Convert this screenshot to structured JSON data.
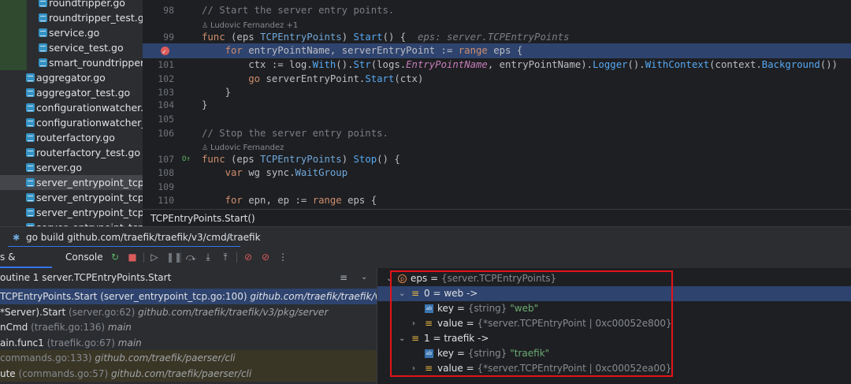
{
  "project_tree": {
    "items": [
      {
        "label": "roundtripper.go",
        "indent": 2
      },
      {
        "label": "roundtripper_test.go",
        "indent": 2
      },
      {
        "label": "service.go",
        "indent": 2
      },
      {
        "label": "service_test.go",
        "indent": 2
      },
      {
        "label": "smart_roundtripper.go",
        "indent": 2
      },
      {
        "label": "aggregator.go",
        "indent": 1
      },
      {
        "label": "aggregator_test.go",
        "indent": 1
      },
      {
        "label": "configurationwatcher.go",
        "indent": 1
      },
      {
        "label": "configurationwatcher_tes",
        "indent": 1
      },
      {
        "label": "routerfactory.go",
        "indent": 1
      },
      {
        "label": "routerfactory_test.go",
        "indent": 1
      },
      {
        "label": "server.go",
        "indent": 1
      },
      {
        "label": "server_entrypoint_tcp.go",
        "indent": 1,
        "selected": true
      },
      {
        "label": "server_entrypoint_tcp_htt",
        "indent": 1
      },
      {
        "label": "server_entrypoint_tcp_htt",
        "indent": 1
      },
      {
        "label": "server_entrypoint_tcp_tes",
        "indent": 1
      }
    ]
  },
  "editor": {
    "lines": [
      {
        "num": "98",
        "tokens": [
          [
            "cm",
            "// Start the server entry points."
          ]
        ]
      },
      {
        "author": "Ludovic Fernandez +1"
      },
      {
        "num": "99",
        "tokens": [
          [
            "kw",
            "func "
          ],
          [
            "pl",
            "(eps "
          ],
          [
            "ty",
            "TCPEntryPoints"
          ],
          [
            "pl",
            ") "
          ],
          [
            "fn",
            "Start"
          ],
          [
            "pl",
            "() {  "
          ],
          [
            "hint",
            "eps: server.TCPEntryPoints"
          ]
        ]
      },
      {
        "num": "",
        "breakpoint": true,
        "highlight": true,
        "tokens": [
          [
            "pl",
            "    "
          ],
          [
            "kw",
            "for "
          ],
          [
            "pl",
            "entryPointName, serverEntryPoint := "
          ],
          [
            "kw",
            "range "
          ],
          [
            "pl",
            "eps {"
          ]
        ]
      },
      {
        "num": "101",
        "tokens": [
          [
            "pl",
            "        ctx := log."
          ],
          [
            "fn",
            "With"
          ],
          [
            "pl",
            "()."
          ],
          [
            "fn",
            "Str"
          ],
          [
            "pl",
            "(logs."
          ],
          [
            "it",
            "EntryPointName"
          ],
          [
            "pl",
            ", entryPointName)."
          ],
          [
            "fn",
            "Logger"
          ],
          [
            "pl",
            "()."
          ],
          [
            "fn",
            "WithContext"
          ],
          [
            "pl",
            "(context."
          ],
          [
            "fn",
            "Background"
          ],
          [
            "pl",
            "())"
          ]
        ]
      },
      {
        "num": "102",
        "tokens": [
          [
            "pl",
            "        "
          ],
          [
            "kw",
            "go "
          ],
          [
            "pl",
            "serverEntryPoint."
          ],
          [
            "fn",
            "Start"
          ],
          [
            "pl",
            "(ctx)"
          ]
        ]
      },
      {
        "num": "103",
        "tokens": [
          [
            "pl",
            "    }"
          ]
        ]
      },
      {
        "num": "104",
        "tokens": [
          [
            "pl",
            "}"
          ]
        ]
      },
      {
        "num": "105",
        "tokens": []
      },
      {
        "num": "106",
        "tokens": [
          [
            "cm",
            "// Stop the server entry points."
          ]
        ]
      },
      {
        "author": "Ludovic Fernandez"
      },
      {
        "num": "107",
        "impl": true,
        "tokens": [
          [
            "kw",
            "func "
          ],
          [
            "pl",
            "(eps "
          ],
          [
            "ty",
            "TCPEntryPoints"
          ],
          [
            "pl",
            ") "
          ],
          [
            "fn",
            "Stop"
          ],
          [
            "pl",
            "() {"
          ]
        ]
      },
      {
        "num": "108",
        "tokens": [
          [
            "pl",
            "    "
          ],
          [
            "kw",
            "var "
          ],
          [
            "pl",
            "wg sync."
          ],
          [
            "ty",
            "WaitGroup"
          ]
        ]
      },
      {
        "num": "109",
        "tokens": []
      },
      {
        "num": "110",
        "tokens": [
          [
            "pl",
            "    "
          ],
          [
            "kw",
            "for "
          ],
          [
            "pl",
            "epn, ep := "
          ],
          [
            "kw",
            "range "
          ],
          [
            "pl",
            "eps {"
          ]
        ]
      }
    ],
    "breadcrumb": "TCPEntryPoints.Start()"
  },
  "run_tab": {
    "label": "go build github.com/traefik/traefik/v3/cmd/traefik",
    "close": "×"
  },
  "debug_toolbar": {
    "tab_frames": "s & Variables",
    "tab_console": "Console",
    "buttons": [
      "rerun-icon",
      "stop-icon",
      "resume-icon",
      "pause-icon",
      "step-over-icon",
      "step-into-icon",
      "step-out-icon",
      "view-breakpoints-icon",
      "mute-breakpoints-icon",
      "more-icon"
    ]
  },
  "frames": {
    "thread": "outine 1 server.TCPEntryPoints.Start",
    "items": [
      {
        "name": "TCPEntryPoints.Start",
        "loc": "(server_entrypoint_tcp.go:100)",
        "pkg": "github.com/traefik/traefik/v3/pkg/serv",
        "selected": true,
        "loc_plain": true
      },
      {
        "name": "*Server).Start",
        "loc": "(server.go:62)",
        "pkg": "github.com/traefik/traefik/v3/pkg/server"
      },
      {
        "name": "nCmd",
        "loc": "(traefik.go:136)",
        "pkg": "main"
      },
      {
        "name": "ain.func1",
        "loc": "(traefik.go:67)",
        "pkg": "main"
      },
      {
        "name": "",
        "loc": "commands.go:133)",
        "pkg": "github.com/traefik/paerser/cli",
        "lib": true
      },
      {
        "name": "ute",
        "loc": "(commands.go:57)",
        "pkg": "github.com/traefik/paerser/cli",
        "lib": true
      }
    ]
  },
  "variables": {
    "rows": [
      {
        "indent": 0,
        "chev": "⌄",
        "icon": "param",
        "name": "eps",
        "eq": " = ",
        "type": "{server.TCPEntryPoints}",
        "value": ""
      },
      {
        "indent": 1,
        "chev": "⌄",
        "icon": "list",
        "name": "0",
        "eq": " = ",
        "type": "",
        "value": "web ->",
        "selected": true
      },
      {
        "indent": 2,
        "chev": "",
        "icon": "field",
        "name": "key",
        "eq": " = ",
        "type": "{string}",
        "value": "\"web\"",
        "str": true
      },
      {
        "indent": 2,
        "chev": "›",
        "icon": "list",
        "name": "value",
        "eq": " = ",
        "type": "{*server.TCPEntryPoint | 0xc00052e800}",
        "value": ""
      },
      {
        "indent": 1,
        "chev": "⌄",
        "icon": "list",
        "name": "1",
        "eq": " = ",
        "type": "",
        "value": "traefik ->"
      },
      {
        "indent": 2,
        "chev": "",
        "icon": "field",
        "name": "key",
        "eq": " = ",
        "type": "{string}",
        "value": "\"traefik\"",
        "str": true
      },
      {
        "indent": 2,
        "chev": "›",
        "icon": "list",
        "name": "value",
        "eq": " = ",
        "type": "{*server.TCPEntryPoint | 0xc00052ea00}",
        "value": ""
      }
    ]
  },
  "colors": {
    "accent": "#3574f0",
    "highlight_box": "#e3131a",
    "selection": "#2e436e"
  }
}
